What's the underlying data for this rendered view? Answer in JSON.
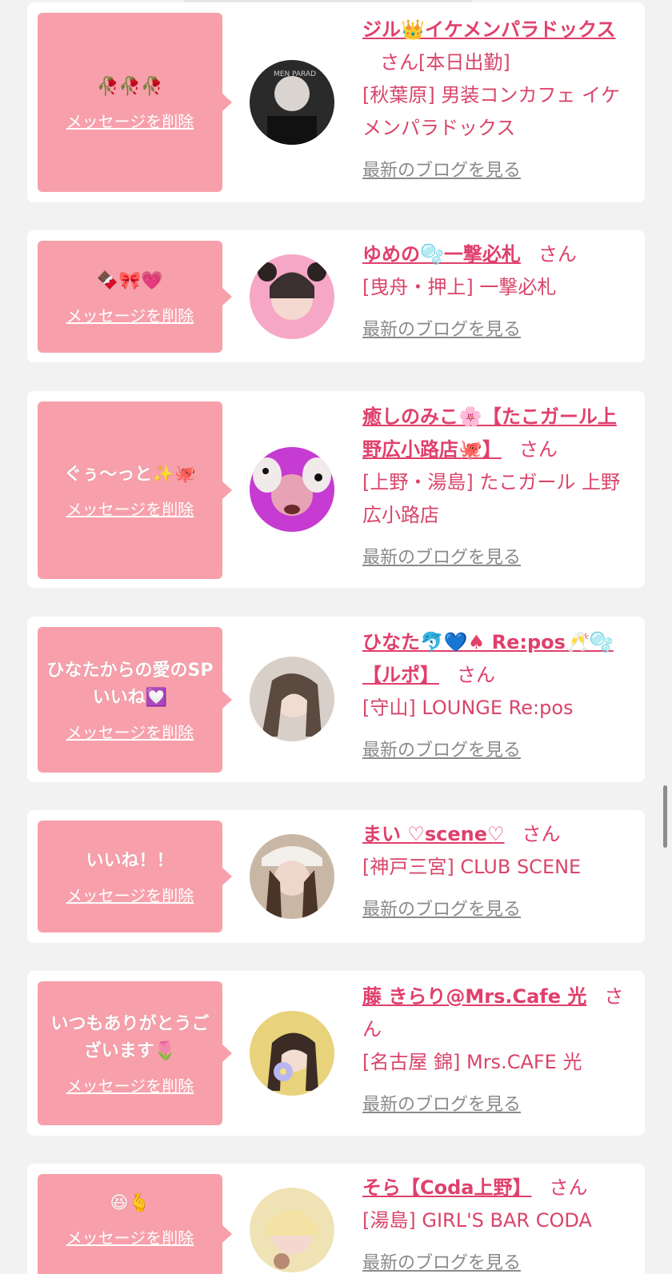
{
  "delete_label": "メッセージを削除",
  "blog_label": "最新のブログを見る",
  "san_label": "さん",
  "items": [
    {
      "message": "🥀🥀🥀",
      "name": "ジル👑イケメンパラドックス",
      "status": "[本日出勤]",
      "shop": "[秋葉原] 男装コンカフェ イケメンパラドックス",
      "avatar_colors": [
        "#2a2a2a",
        "#d9d4cf"
      ]
    },
    {
      "message": "🍫🎀💗",
      "name": "ゆめの🫧一撃必札",
      "status": "",
      "shop": "[曳舟・押上] 一撃必札",
      "avatar_colors": [
        "#f6a7c6",
        "#3b2f2f"
      ]
    },
    {
      "message": "ぐぅ〜っと✨🐙",
      "name": "癒しのみこ🌸【たこガール上野広小路店🐙】",
      "status": "",
      "shop": "[上野・湯島] たこガール 上野広小路店",
      "avatar_colors": [
        "#c63bd1",
        "#f0eaea"
      ]
    },
    {
      "message": "ひなたからの愛のSPいいね💟",
      "name": "ひなた🐬💙♠ Re:pos🥂🫧【ルポ】",
      "status": "",
      "shop": "[守山] LOUNGE Re:pos",
      "avatar_colors": [
        "#d8cfc8",
        "#5a4a40"
      ]
    },
    {
      "message": "いいね！！",
      "name": "まい ♡scene♡",
      "status": "",
      "shop": "[神戸三宮] CLUB SCENE",
      "avatar_colors": [
        "#c9b7a6",
        "#4a3327"
      ]
    },
    {
      "message": "いつもありがとうございます🌷",
      "name": "藤 きらり@Mrs.Cafe 光",
      "status": "",
      "shop": "[名古屋 錦] Mrs.CAFE 光",
      "avatar_colors": [
        "#e9d27c",
        "#3a2c25"
      ]
    },
    {
      "message": "😆🫰",
      "name": "そら【Coda上野】",
      "status": "",
      "shop": "[湯島] GIRL'S BAR CODA",
      "avatar_colors": [
        "#efe3b5",
        "#b88a74"
      ]
    }
  ]
}
